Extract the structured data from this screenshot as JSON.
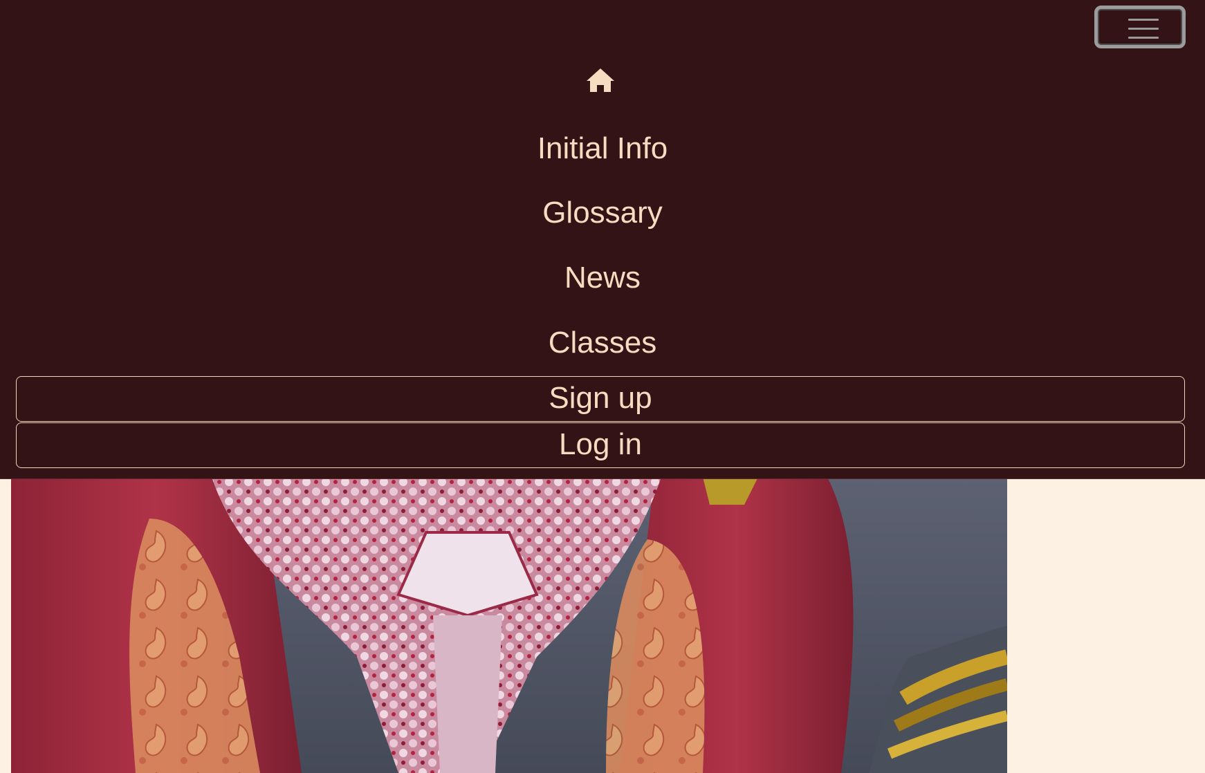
{
  "nav": {
    "home_icon": "home-icon",
    "menu_toggle_icon": "hamburger-menu-icon",
    "links": [
      {
        "label": "Initial Info"
      },
      {
        "label": "Glossary"
      },
      {
        "label": "News"
      },
      {
        "label": "Classes"
      }
    ],
    "signup_label": "Sign up",
    "login_label": "Log in"
  },
  "colors": {
    "navbar_bg": "#331316",
    "nav_text": "#f6dcc0",
    "page_bg": "#fdf1e3"
  }
}
